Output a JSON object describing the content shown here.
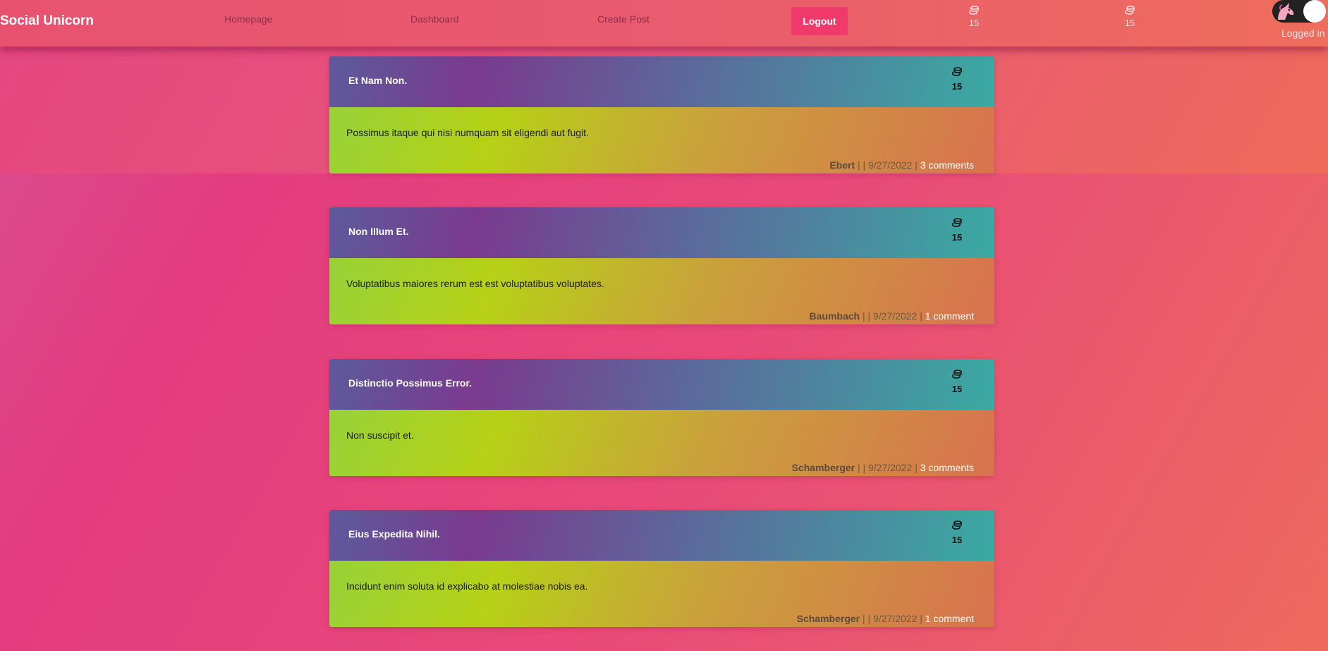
{
  "navbar": {
    "brand": "Social Unicorn",
    "links": [
      "Homepage",
      "Dashboard",
      "Create Post"
    ],
    "logout_label": "Logout",
    "counter_1": "15",
    "counter_2": "15",
    "status": "Logged in"
  },
  "posts": [
    {
      "title": "Et Nam Non.",
      "coins": "15",
      "body": "Possimus itaque qui nisi numquam sit eligendi aut fugit.",
      "author": "Ebert",
      "separator": " | | 9/27/2022 | ",
      "comments": "3 comments"
    },
    {
      "title": "Non Illum Et.",
      "coins": "15",
      "body": "Voluptatibus maiores rerum est est voluptatibus voluptates.",
      "author": "Baumbach",
      "separator": " | | 9/27/2022 | ",
      "comments": "1 comment"
    },
    {
      "title": "Distinctio Possimus Error.",
      "coins": "15",
      "body": "Non suscipit et.",
      "author": "Schamberger",
      "separator": " | | 9/27/2022 | ",
      "comments": "3 comments"
    },
    {
      "title": "Eius Expedita Nihil.",
      "coins": "15",
      "body": "Incidunt enim soluta id explicabo at molestiae nobis ea.",
      "author": "Schamberger",
      "separator": " | | 9/27/2022 | ",
      "comments": "1 comment"
    }
  ],
  "icons": {
    "coins": "coins-icon",
    "unicorn": "unicorn-icon"
  },
  "colors": {
    "logout_button": "#ef3a6b",
    "background": "#e33c7f"
  }
}
